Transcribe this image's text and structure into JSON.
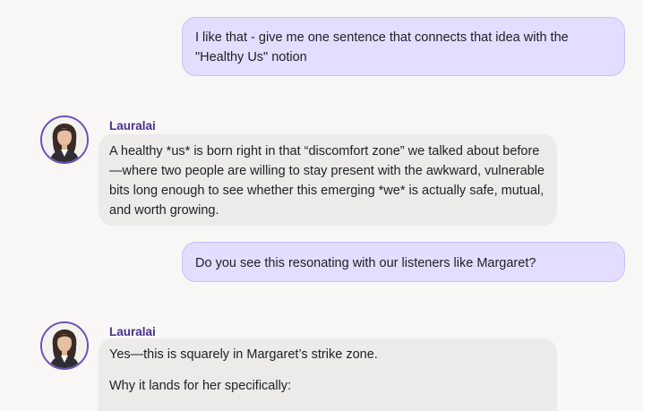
{
  "messages": [
    {
      "role": "user",
      "text": "I like that - give me one sentence that connects that idea with the \"Healthy Us\" notion"
    },
    {
      "role": "assistant",
      "sender": "Lauralai",
      "avatar_icon": "woman-portrait-avatar",
      "text": "A healthy *us* is born right in that “discomfort zone” we talked about before—where two people are willing to stay present with the awkward, vulnerable bits long enough to see whether this emerging *we* is actually safe, mutual, and worth growing."
    },
    {
      "role": "user",
      "text": "Do you see this resonating with our listeners like Margaret?"
    },
    {
      "role": "assistant",
      "sender": "Lauralai",
      "avatar_icon": "woman-portrait-avatar",
      "paragraphs": [
        "Yes—this is squarely in Margaret’s strike zone.",
        "Why it lands for her specifically:"
      ]
    }
  ],
  "colors": {
    "user_bubble": "#e3ddff",
    "assistant_bubble": "#ecebea",
    "sender_name": "#4a2f8c",
    "avatar_border": "#6a4fb5",
    "background": "#f8f7f6"
  }
}
